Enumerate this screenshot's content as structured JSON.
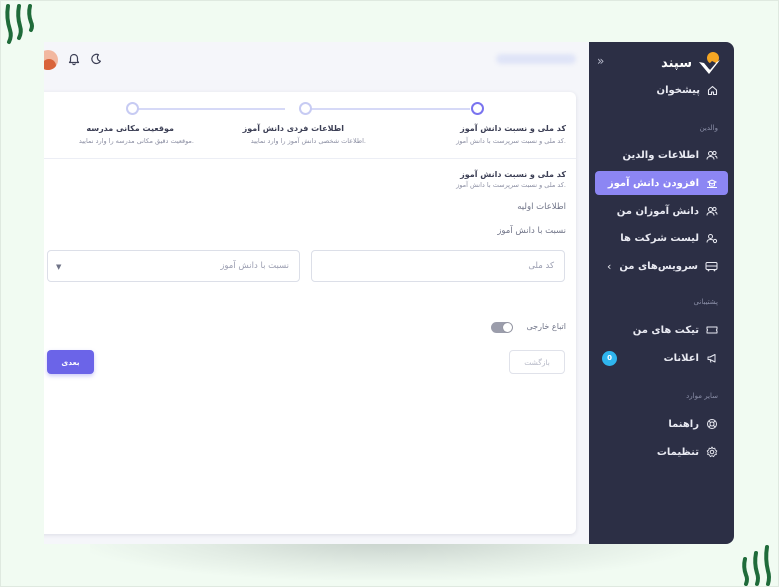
{
  "sidebar": {
    "brand": "سپند",
    "sections": {
      "parents": "والدین",
      "support": "پشتیبانی",
      "other": "سایر موارد"
    },
    "items": [
      {
        "label": "پیشخوان"
      },
      {
        "label": "اطلاعات والدین"
      },
      {
        "label": "افزودن دانش آموز"
      },
      {
        "label": "دانش آموزان من"
      },
      {
        "label": "لیست شرکت ها"
      },
      {
        "label": "سرویس‌های من"
      },
      {
        "label": "تیکت های من"
      },
      {
        "label": "اعلانات"
      },
      {
        "label": "راهنما"
      },
      {
        "label": "تنظیمات"
      }
    ],
    "notifications_badge": "0"
  },
  "stepper": [
    {
      "title": "کد ملی و نسبت دانش آموز",
      "desc": "کد ملی و نسبت سرپرست با دانش آموز.",
      "active": true
    },
    {
      "title": "اطلاعات فردی دانش آموز",
      "desc": "اطلاعات شخصی دانش آموز را وارد نمایید.",
      "active": false
    },
    {
      "title": "موقعیت مکانی مدرسه",
      "desc": "موقعیت دقیق مکانی مدرسه را وارد نمایید.",
      "active": false
    }
  ],
  "form": {
    "title": "کد ملی و نسبت دانش آموز",
    "subtitle": "کد ملی و نسبت سرپرست با دانش آموز.",
    "basic_info": "اطلاعات اولیه",
    "relation_heading": "نسبت با دانش آموز",
    "national_code_placeholder": "کد ملی",
    "relation_placeholder": "نسبت با دانش آموز",
    "foreign_label": "اتباع خارجی",
    "back_label": "بازگشت",
    "next_label": "بعدی"
  },
  "colors": {
    "sidebar_bg": "#2c2f45",
    "accent": "#6b64e8",
    "active_item": "#8c86f3",
    "badge": "#2fb5ee",
    "brand_orange": "#f5a623"
  }
}
